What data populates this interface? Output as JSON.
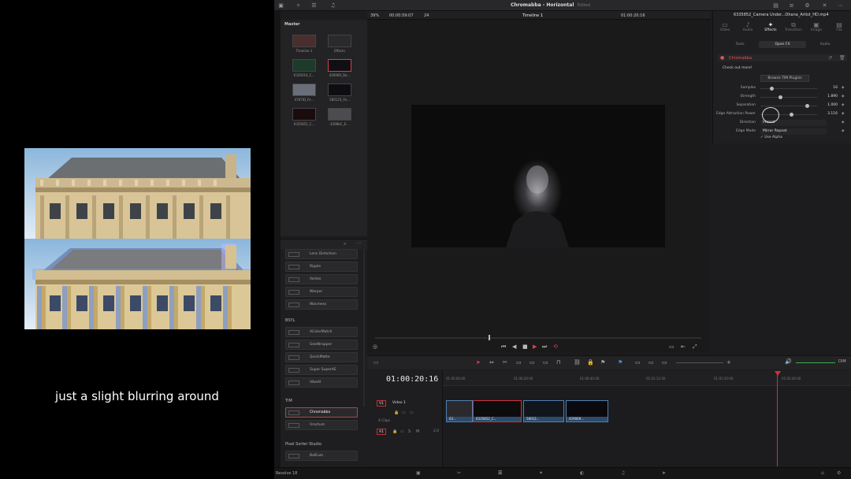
{
  "caption": "just a slight blurring around",
  "app": {
    "title": "Chromabba - Horizontal",
    "edited": "Edited"
  },
  "viewer_bar": {
    "zoom": "39%",
    "src_tc": "00:00:59:07",
    "fps": "24",
    "timeline_name": "Timeline 1",
    "rec_tc": "01:00:20:16"
  },
  "media_pool": {
    "header": "Master",
    "clips": [
      {
        "name": "Timeline 1"
      },
      {
        "name": "Effects"
      },
      {
        "name": "6335014_C..."
      },
      {
        "name": "429069_Da..."
      },
      {
        "name": "4787ID_Fe..."
      },
      {
        "name": "580123_Fe..."
      },
      {
        "name": "6335852_C..."
      },
      {
        "name": "4298bC_E..."
      }
    ]
  },
  "effects_library": {
    "items_top": [
      "Lens Distortion",
      "Ripple",
      "Vortex",
      "Warper",
      "Waviness"
    ],
    "group_bsyl": "BSYL",
    "items_bsyl": [
      "AColorMatch",
      "GeoWrapper",
      "QuickMatte",
      "Super SuperAE",
      "VibeAI"
    ],
    "group_tim": "TIM",
    "items_tim": [
      "Chromabba",
      "Vrectum"
    ],
    "group_pixel": "Pixel Sorter Studio",
    "items_pixel": [
      "BalEum"
    ]
  },
  "inspector": {
    "file_title": "6335852_Camera Under...Ohana_Artist_HD.mp4",
    "tabs": [
      "Video",
      "Audio",
      "Effects",
      "Transition",
      "Image",
      "File"
    ],
    "subtabs": [
      "Tools",
      "Open FX",
      "Audio"
    ],
    "effect_name": "Chromabba",
    "check_out": "Check out more!",
    "browse_button": "Browse TIM Plugins",
    "params": [
      {
        "label": "Samples",
        "value": "16",
        "fill": 0.2
      },
      {
        "label": "Strength",
        "value": "1.890",
        "fill": 0.35
      },
      {
        "label": "Separation",
        "value": "1.000",
        "fill": 0.82
      },
      {
        "label": "Edge Attraction Power",
        "value": "3.116",
        "fill": 0.55
      }
    ],
    "direction_label": "Direction",
    "direction_value": "Inward",
    "edge_mode_label": "Edge Mode",
    "edge_mode_value": "Mirror Repeat",
    "use_alpha": "Use Alpha"
  },
  "timeline": {
    "timecode": "01:00:20:16",
    "ruler": [
      "01:00:00:00",
      "01:00:20:00",
      "01:00:40:00",
      "01:01:12:00",
      "01:01:20:00",
      "01:02:00:00"
    ],
    "video_track": {
      "badge": "V1",
      "name": "Video 1",
      "clips_count": "4 Clips"
    },
    "audio_track": {
      "badge": "A1",
      "level": "2.0"
    },
    "clips": [
      {
        "name": "63..."
      },
      {
        "name": "6335852_C..."
      },
      {
        "name": "58012..."
      },
      {
        "name": "429069..."
      }
    ],
    "volume": "DIM"
  },
  "page_bar": {
    "left_label": "Resolve 18"
  }
}
